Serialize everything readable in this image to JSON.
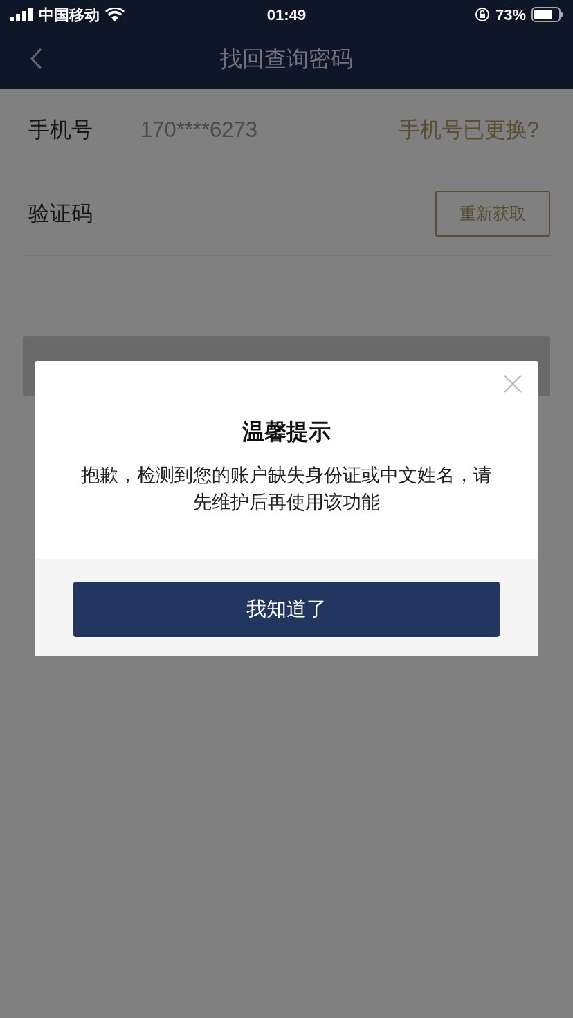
{
  "status_bar": {
    "carrier": "中国移动",
    "time": "01:49",
    "battery": "73%"
  },
  "nav": {
    "title": "找回查询密码"
  },
  "form": {
    "phone_label": "手机号",
    "phone_value": "170****6273",
    "phone_changed_link": "手机号已更换?",
    "code_label": "验证码",
    "resend_button": "重新获取"
  },
  "dialog": {
    "title": "温馨提示",
    "message": "抱歉，检测到您的账户缺失身份证或中文姓名，请先维护后再使用该功能",
    "confirm_button": "我知道了"
  }
}
